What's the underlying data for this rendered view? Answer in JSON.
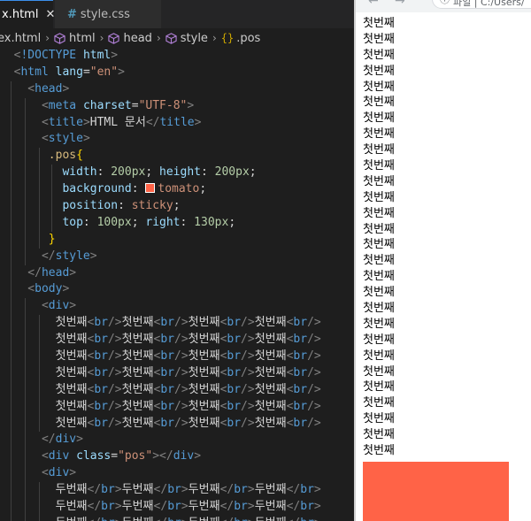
{
  "editor": {
    "tabs": [
      {
        "label": "x.html",
        "close": "✕"
      },
      {
        "label": "style.css",
        "icon": "#"
      }
    ],
    "breadcrumb": [
      "ex.html",
      "html",
      "head",
      "style",
      ".pos"
    ],
    "colors": {
      "tomato": "#ff6347",
      "tab_accent": "#3b8eea"
    }
  },
  "browser": {
    "address": "파일 | C:/Users/",
    "first_text": "첫번째",
    "first_lines_visible": 28,
    "pos_color": "#ff6347"
  }
}
